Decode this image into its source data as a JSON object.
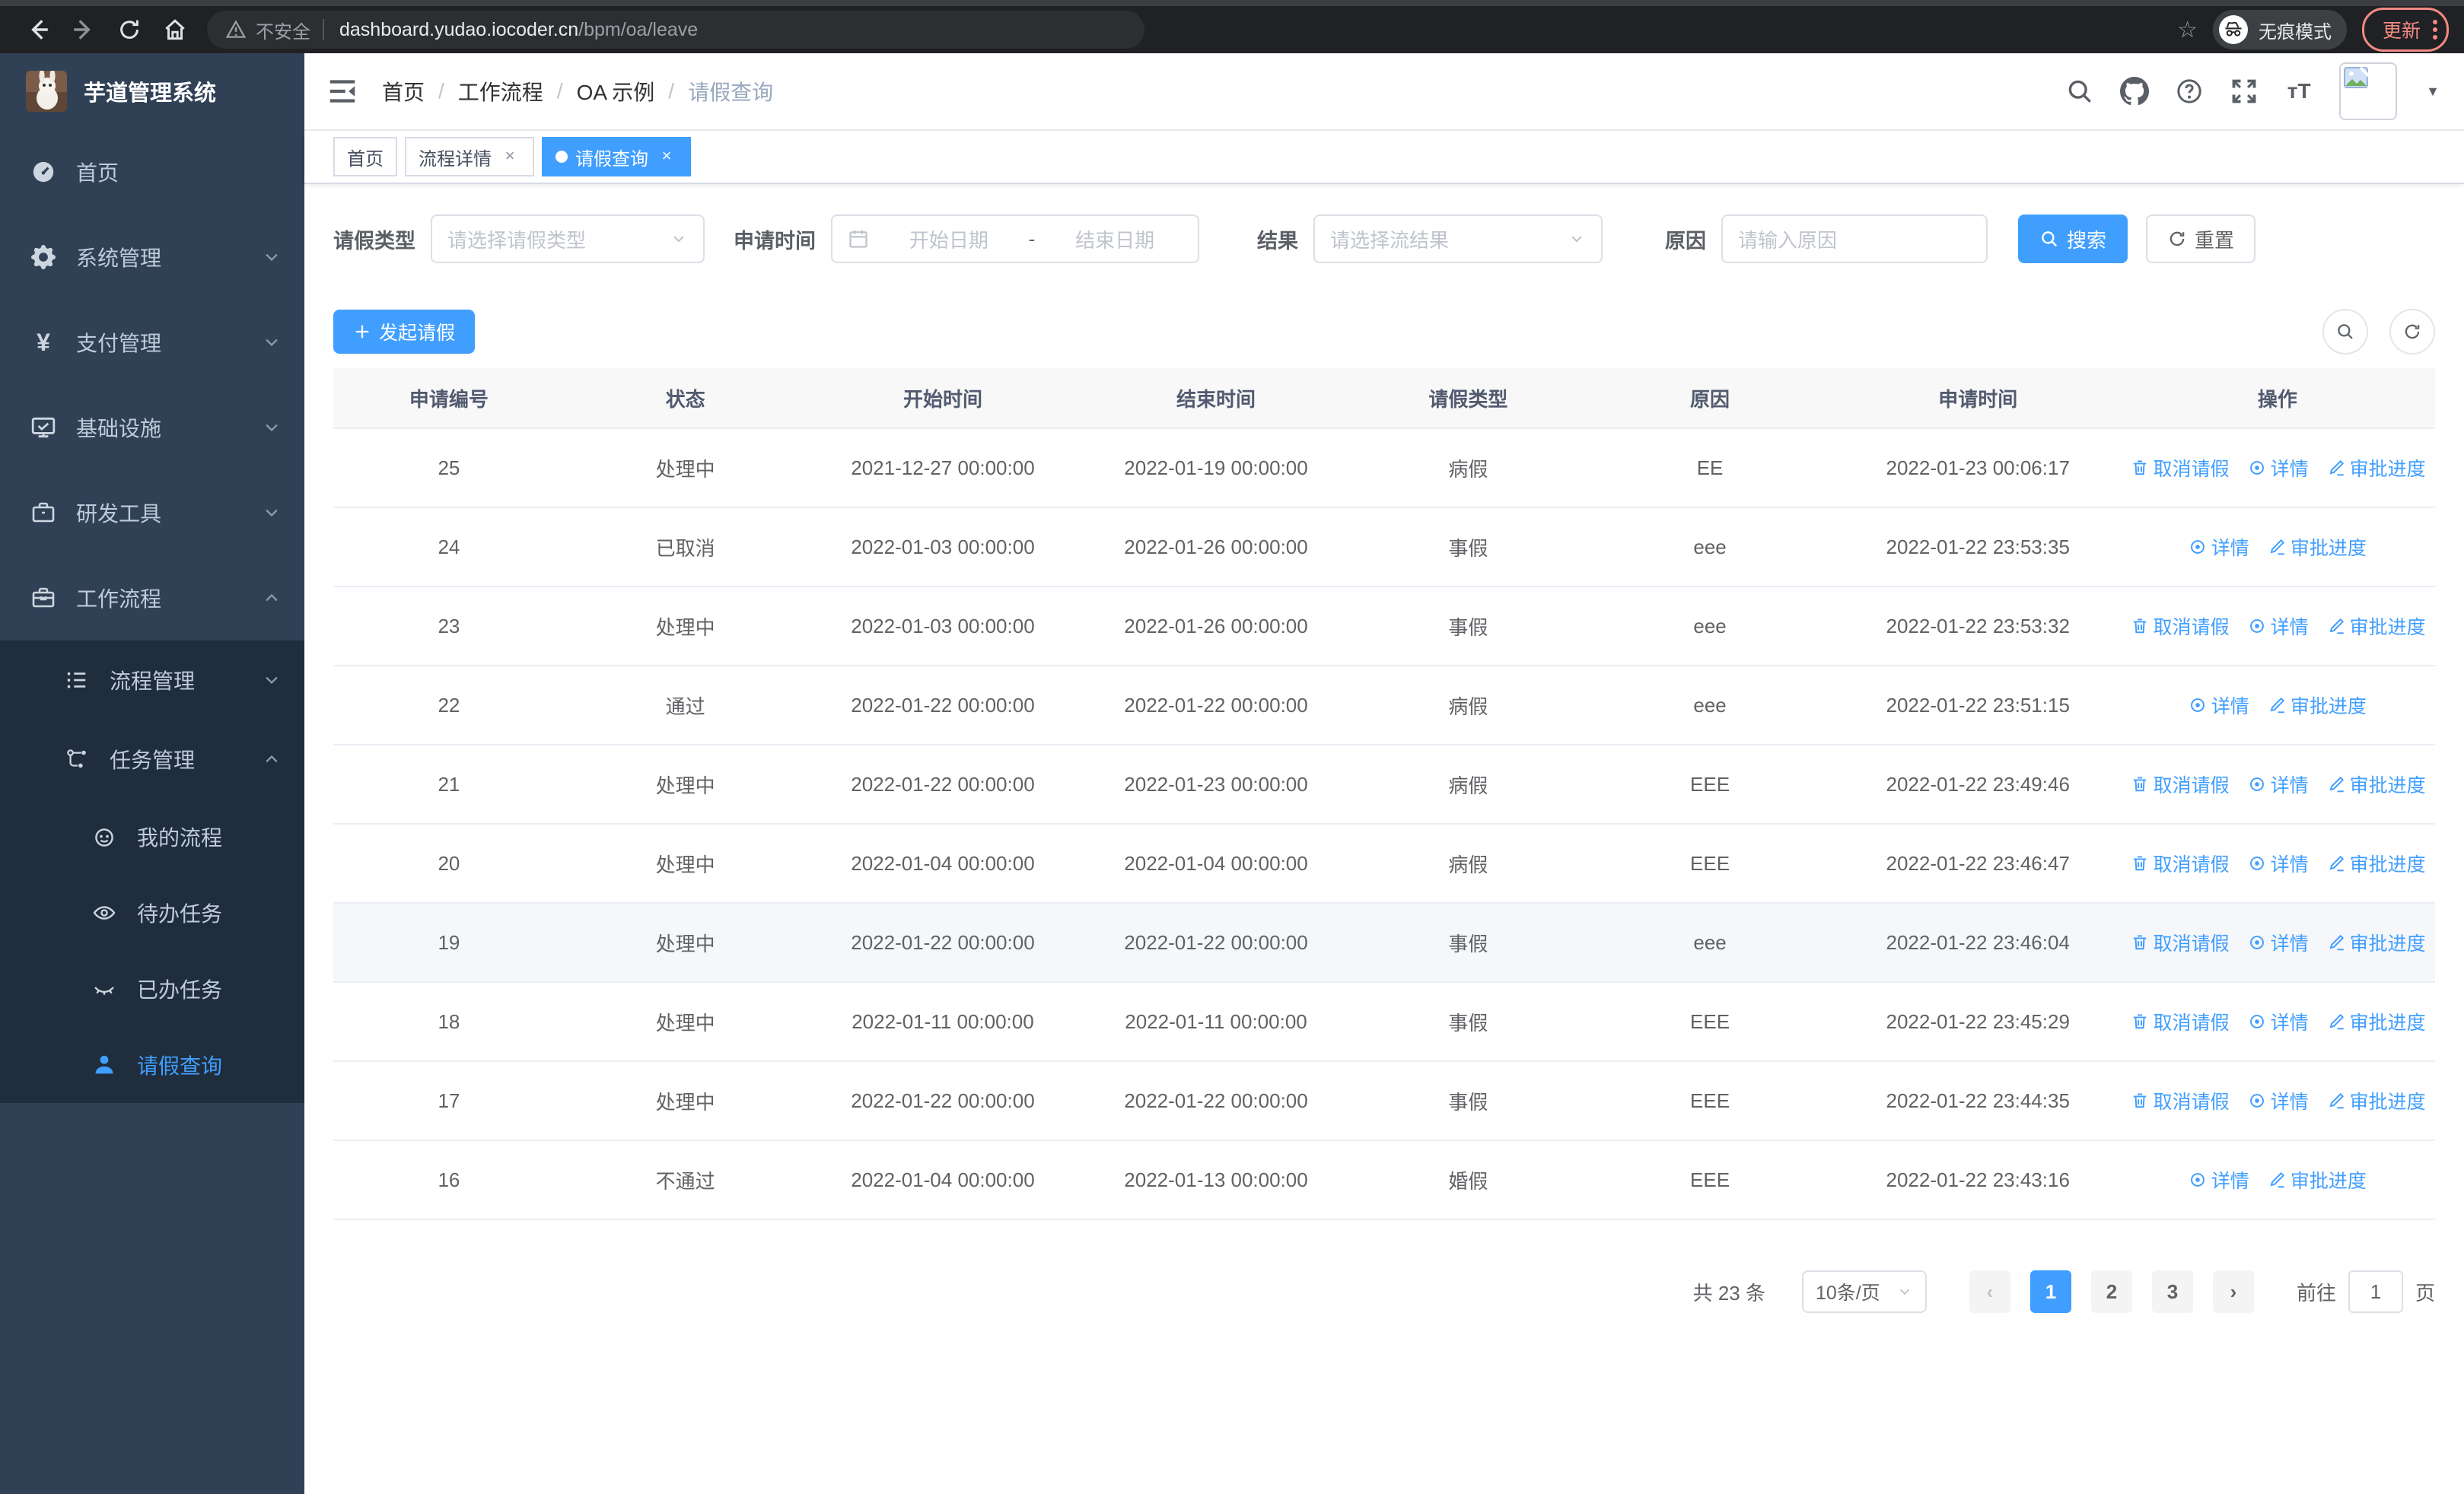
{
  "browser": {
    "security_label": "不安全",
    "url_host": "dashboard.yudao.iocoder.cn",
    "url_path": "/bpm/oa/leave",
    "incognito_label": "无痕模式",
    "update_label": "更新"
  },
  "sidebar": {
    "title": "芋道管理系统",
    "items": [
      {
        "label": "首页"
      },
      {
        "label": "系统管理"
      },
      {
        "label": "支付管理"
      },
      {
        "label": "基础设施"
      },
      {
        "label": "研发工具"
      },
      {
        "label": "工作流程"
      }
    ],
    "submenu": [
      {
        "label": "流程管理"
      },
      {
        "label": "任务管理"
      }
    ],
    "children": [
      {
        "label": "我的流程"
      },
      {
        "label": "待办任务"
      },
      {
        "label": "已办任务"
      },
      {
        "label": "请假查询"
      }
    ]
  },
  "navbar": {
    "breadcrumb": [
      "首页",
      "工作流程",
      "OA 示例",
      "请假查询"
    ]
  },
  "tabs": [
    {
      "label": "首页",
      "closable": false,
      "active": false
    },
    {
      "label": "流程详情",
      "closable": true,
      "active": false
    },
    {
      "label": "请假查询",
      "closable": true,
      "active": true
    }
  ],
  "filters": {
    "leave_type_label": "请假类型",
    "leave_type_placeholder": "请选择请假类型",
    "apply_time_label": "申请时间",
    "date_start_placeholder": "开始日期",
    "date_separator": "-",
    "date_end_placeholder": "结束日期",
    "result_label": "结果",
    "result_placeholder": "请选择流结果",
    "reason_label": "原因",
    "reason_placeholder": "请输入原因",
    "search_label": "搜索",
    "reset_label": "重置"
  },
  "toolbar": {
    "create_label": "发起请假"
  },
  "table": {
    "columns": [
      "申请编号",
      "状态",
      "开始时间",
      "结束时间",
      "请假类型",
      "原因",
      "申请时间",
      "操作"
    ],
    "action_labels": {
      "cancel": "取消请假",
      "detail": "详情",
      "progress": "审批进度"
    },
    "rows": [
      {
        "id": "25",
        "status": "处理中",
        "start": "2021-12-27 00:00:00",
        "end": "2022-01-19 00:00:00",
        "type": "病假",
        "reason": "EE",
        "apply": "2022-01-23 00:06:17",
        "actions": [
          "cancel",
          "detail",
          "progress"
        ],
        "hover": false
      },
      {
        "id": "24",
        "status": "已取消",
        "start": "2022-01-03 00:00:00",
        "end": "2022-01-26 00:00:00",
        "type": "事假",
        "reason": "eee",
        "apply": "2022-01-22 23:53:35",
        "actions": [
          "detail",
          "progress"
        ],
        "hover": false
      },
      {
        "id": "23",
        "status": "处理中",
        "start": "2022-01-03 00:00:00",
        "end": "2022-01-26 00:00:00",
        "type": "事假",
        "reason": "eee",
        "apply": "2022-01-22 23:53:32",
        "actions": [
          "cancel",
          "detail",
          "progress"
        ],
        "hover": false
      },
      {
        "id": "22",
        "status": "通过",
        "start": "2022-01-22 00:00:00",
        "end": "2022-01-22 00:00:00",
        "type": "病假",
        "reason": "eee",
        "apply": "2022-01-22 23:51:15",
        "actions": [
          "detail",
          "progress"
        ],
        "hover": false
      },
      {
        "id": "21",
        "status": "处理中",
        "start": "2022-01-22 00:00:00",
        "end": "2022-01-23 00:00:00",
        "type": "病假",
        "reason": "EEE",
        "apply": "2022-01-22 23:49:46",
        "actions": [
          "cancel",
          "detail",
          "progress"
        ],
        "hover": false
      },
      {
        "id": "20",
        "status": "处理中",
        "start": "2022-01-04 00:00:00",
        "end": "2022-01-04 00:00:00",
        "type": "病假",
        "reason": "EEE",
        "apply": "2022-01-22 23:46:47",
        "actions": [
          "cancel",
          "detail",
          "progress"
        ],
        "hover": false
      },
      {
        "id": "19",
        "status": "处理中",
        "start": "2022-01-22 00:00:00",
        "end": "2022-01-22 00:00:00",
        "type": "事假",
        "reason": "eee",
        "apply": "2022-01-22 23:46:04",
        "actions": [
          "cancel",
          "detail",
          "progress"
        ],
        "hover": true
      },
      {
        "id": "18",
        "status": "处理中",
        "start": "2022-01-11 00:00:00",
        "end": "2022-01-11 00:00:00",
        "type": "事假",
        "reason": "EEE",
        "apply": "2022-01-22 23:45:29",
        "actions": [
          "cancel",
          "detail",
          "progress"
        ],
        "hover": false
      },
      {
        "id": "17",
        "status": "处理中",
        "start": "2022-01-22 00:00:00",
        "end": "2022-01-22 00:00:00",
        "type": "事假",
        "reason": "EEE",
        "apply": "2022-01-22 23:44:35",
        "actions": [
          "cancel",
          "detail",
          "progress"
        ],
        "hover": false
      },
      {
        "id": "16",
        "status": "不通过",
        "start": "2022-01-04 00:00:00",
        "end": "2022-01-13 00:00:00",
        "type": "婚假",
        "reason": "EEE",
        "apply": "2022-01-22 23:43:16",
        "actions": [
          "detail",
          "progress"
        ],
        "hover": false
      }
    ]
  },
  "pagination": {
    "total_label": "共 23 条",
    "page_size_label": "10条/页",
    "pages": [
      {
        "label": "1",
        "active": true
      },
      {
        "label": "2",
        "active": false
      },
      {
        "label": "3",
        "active": false
      }
    ],
    "goto_label": "前往",
    "goto_value": "1",
    "page_unit": "页"
  },
  "colors": {
    "accent": "#409eff",
    "sidebar_bg": "#304156",
    "submenu_bg": "#1f2d3d",
    "update_chip": "#f28b82"
  }
}
